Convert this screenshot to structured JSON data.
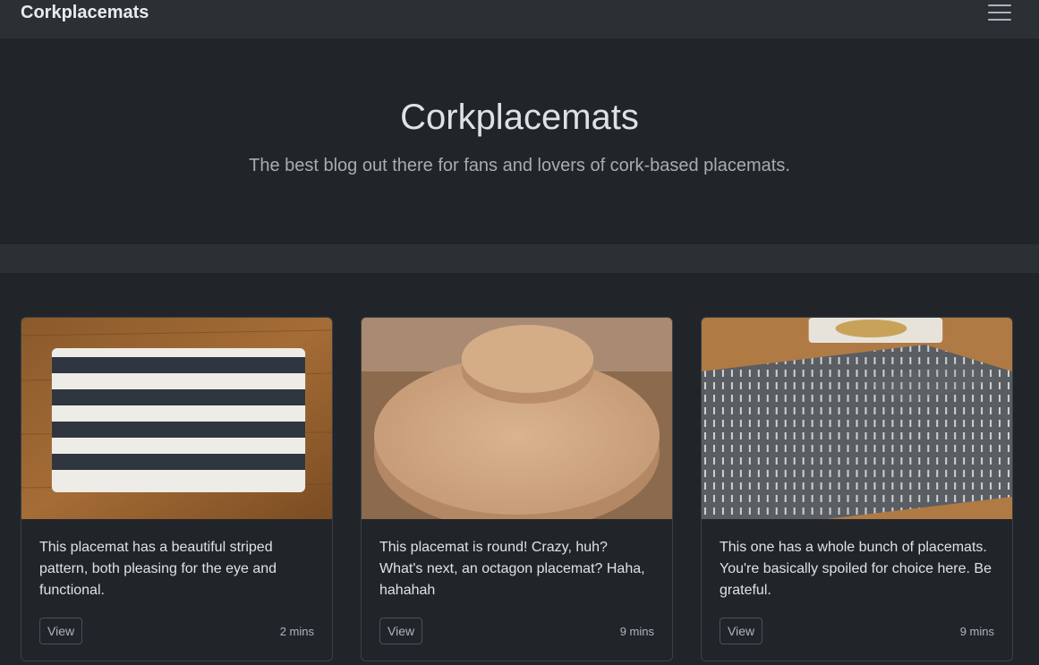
{
  "navbar": {
    "brand": "Corkplacemats",
    "toggler_icon": "hamburger-icon"
  },
  "hero": {
    "title": "Corkplacemats",
    "subtitle": "The best blog out there for fans and lovers of cork-based placemats."
  },
  "cards": [
    {
      "image": "striped-placemat-photo",
      "text": "This placemat has a beautiful striped pattern, both pleasing for the eye and functional.",
      "button_label": "View",
      "time": "2 mins"
    },
    {
      "image": "round-cork-placemat-photo",
      "text": "This placemat is round! Crazy, huh? What's next, an octagon placemat? Haha, hahahah",
      "button_label": "View",
      "time": "9 mins"
    },
    {
      "image": "patterned-placemat-set-photo",
      "text": "This one has a whole bunch of placemats. You're basically spoiled for choice here. Be grateful.",
      "button_label": "View",
      "time": "9 mins"
    }
  ]
}
